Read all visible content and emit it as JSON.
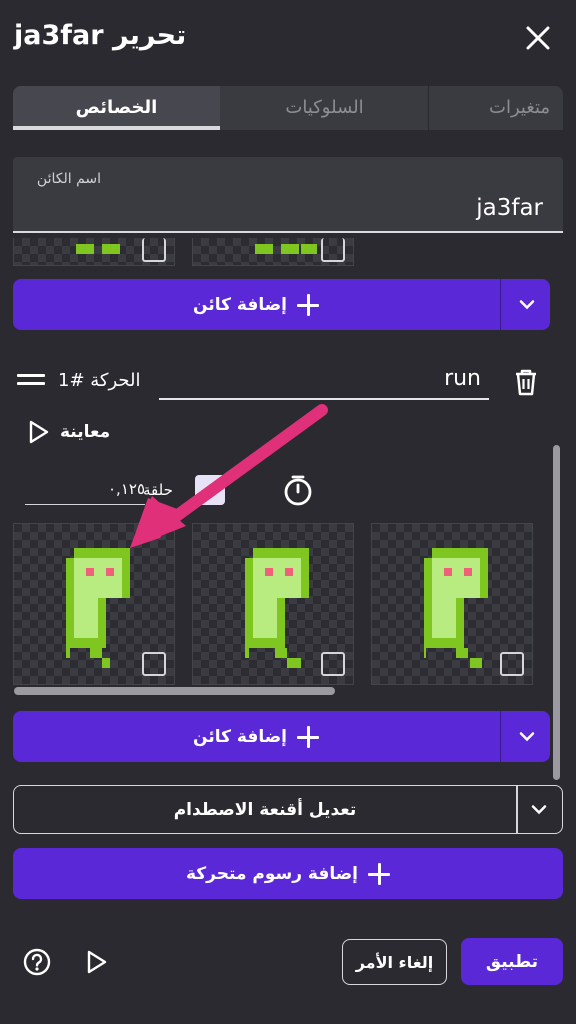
{
  "header": {
    "title": "تحرير ja3far"
  },
  "tabs": [
    {
      "label": "الخصائص",
      "active": true
    },
    {
      "label": "السلوكيات",
      "active": false
    },
    {
      "label": "متغيرات",
      "active": false
    }
  ],
  "object_name": {
    "label": "اسم الكائن",
    "value": "ja3far"
  },
  "add_object_label": "إضافة كائن",
  "animation": {
    "number_label": "الحركة #1",
    "name_value": "run",
    "preview_label": "معاينة",
    "speed_value": "٠,١٢٥",
    "loop_label": "حلقة"
  },
  "collision_masks_label": "تعديل أقنعة الاصطدام",
  "add_animations_label": "إضافة رسوم متحركة",
  "footer": {
    "cancel_label": "إلغاء الأمر",
    "apply_label": "تطبيق"
  },
  "colors": {
    "accent": "#5a28d6",
    "background": "#2a2a30",
    "sprite_green": "#7fc620",
    "sprite_light": "#b8ec80",
    "sprite_eye": "#f0607a",
    "annotation_arrow": "#e0307a"
  },
  "icons": [
    "close-icon",
    "drag-handle-icon",
    "trash-icon",
    "play-icon",
    "timer-icon",
    "chevron-down-icon",
    "plus-icon",
    "help-icon"
  ]
}
